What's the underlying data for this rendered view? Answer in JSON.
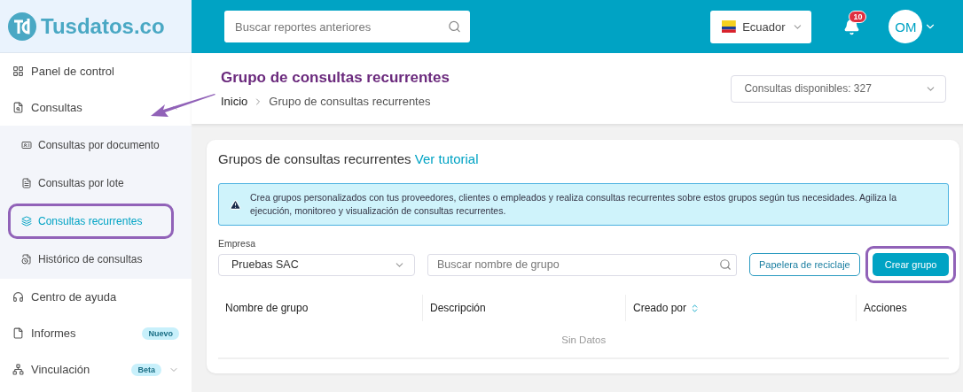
{
  "header": {
    "logo": "Tusdatos.co",
    "search": {
      "placeholder": "Buscar reportes anteriores"
    },
    "country": "Ecuador",
    "notifications": "10",
    "avatar": "OM"
  },
  "sidebar": {
    "items": [
      {
        "label": "Panel de control",
        "selected": false
      },
      {
        "label": "Consultas",
        "selected": false,
        "expanded": true,
        "children": [
          {
            "label": "Consultas por documento",
            "selected": false,
            "highlighted": false
          },
          {
            "label": "Consultas por lote",
            "selected": false,
            "highlighted": false
          },
          {
            "label": "Consultas recurrentes",
            "selected": true,
            "highlighted": true
          },
          {
            "label": "Histórico de consultas",
            "selected": false,
            "highlighted": false
          }
        ]
      },
      {
        "label": "Centro de ayuda",
        "selected": false
      },
      {
        "label": "Informes",
        "selected": false,
        "badge": "Nuevo"
      },
      {
        "label": "Vinculación",
        "selected": false,
        "badge": "Beta",
        "expanded": false
      }
    ]
  },
  "page": {
    "title": "Grupo de consultas recurrentes",
    "breadcrumb": [
      "Inicio",
      "Grupo de consultas recurrentes"
    ],
    "quota": "Consultas disponibles: 327"
  },
  "card": {
    "title": "Grupos de consultas recurrentes",
    "link": "Ver tutorial",
    "alert": "Crea grupos personalizados con tus proveedores, clientes o empleados y realiza consultas recurrentes sobre estos grupos según tus necesidades. Agiliza la ejecución, monitoreo y visualización de consultas recurrentes.",
    "company": {
      "label": "Empresa",
      "value": "Pruebas SAC"
    },
    "group_search": {
      "placeholder": "Buscar nombre de grupo"
    },
    "buttons": [
      {
        "label": "Papelera de reciclaje",
        "kind": "outline",
        "highlighted": false
      },
      {
        "label": "Crear grupo",
        "kind": "primary",
        "highlighted": true
      }
    ],
    "table": {
      "columns": [
        {
          "label": "Nombre de grupo",
          "sortable": false
        },
        {
          "label": "Descripción",
          "sortable": false
        },
        {
          "label": "Creado por",
          "sortable": true
        },
        {
          "label": "Acciones",
          "sortable": false
        }
      ],
      "empty": "Sin Datos"
    }
  },
  "annotations": [
    {
      "kind": "arrow"
    }
  ]
}
